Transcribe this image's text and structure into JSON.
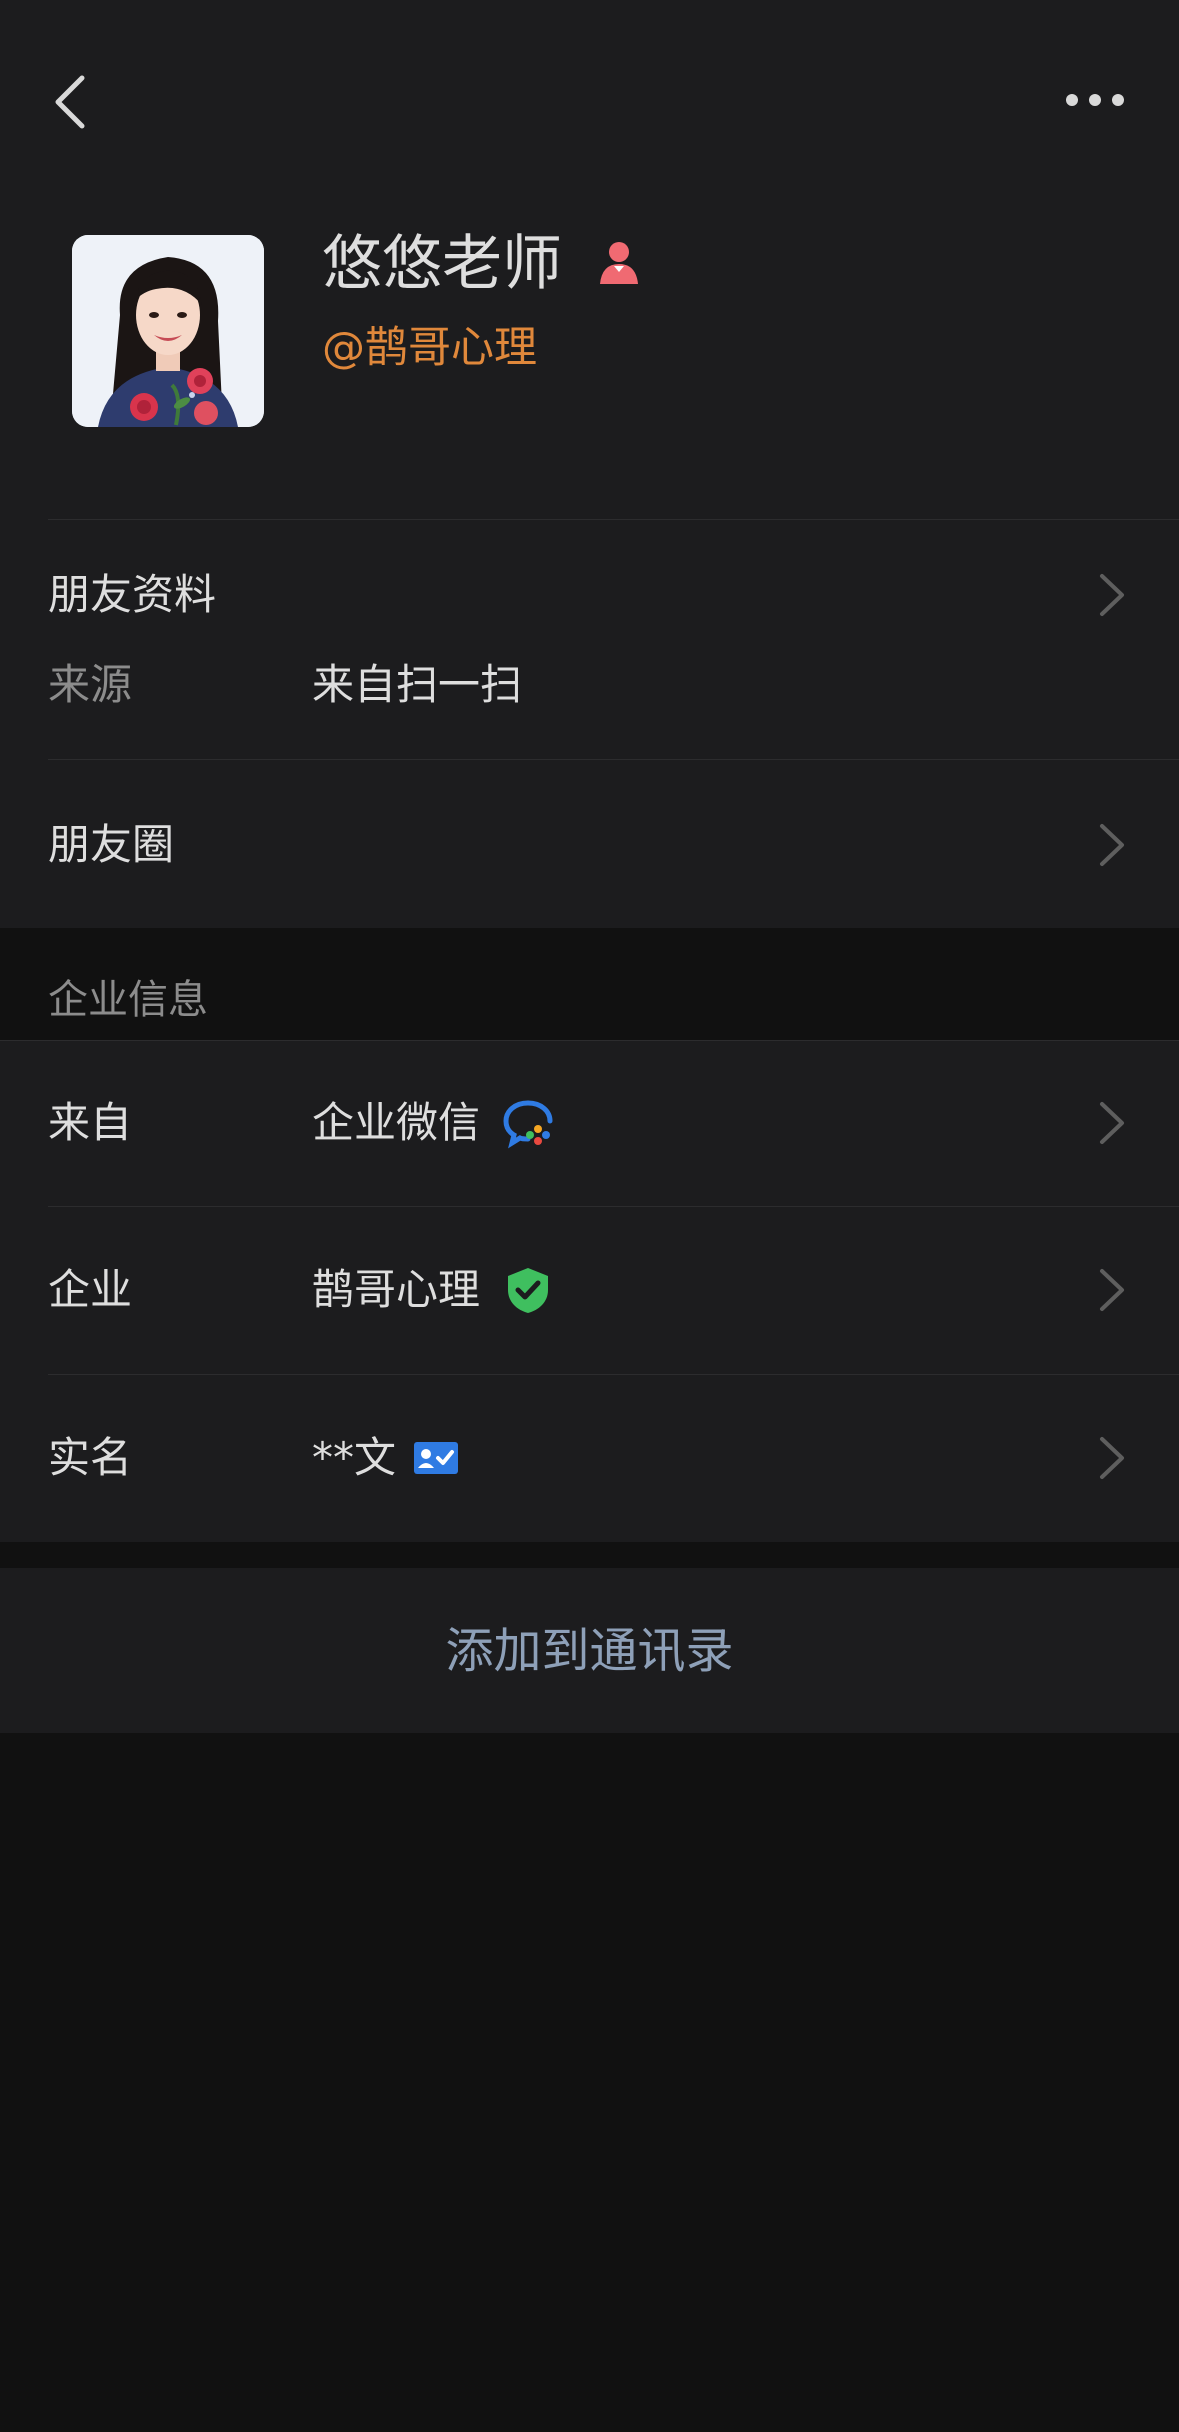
{
  "profile": {
    "display_name": "悠悠老师",
    "corp_tag": "@鹊哥心理",
    "gender_icon": "female-person-icon"
  },
  "friend_info": {
    "title": "朋友资料",
    "source_label": "来源",
    "source_value": "来自扫一扫"
  },
  "moments": {
    "title": "朋友圈"
  },
  "enterprise": {
    "section_header": "企业信息",
    "from_label": "来自",
    "from_value": "企业微信",
    "from_icon": "wecom-logo-icon",
    "company_label": "企业",
    "company_value": "鹊哥心理",
    "company_icon": "verified-shield-icon",
    "realname_label": "实名",
    "realname_value": "**文",
    "realname_icon": "id-card-verified-icon"
  },
  "actions": {
    "add_contact": "添加到通讯录"
  },
  "colors": {
    "background": "#111111",
    "surface": "#1c1c1e",
    "corp_tag": "#e0883b",
    "action_text": "#8ea0b8",
    "verified_green": "#3fbf5f",
    "wecom_blue": "#2f7be3"
  }
}
